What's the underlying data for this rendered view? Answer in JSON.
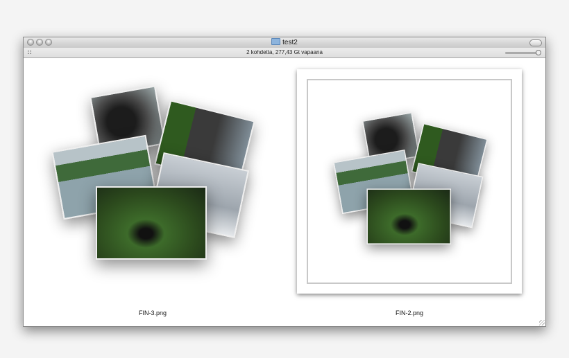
{
  "window": {
    "title": "test2",
    "status": "2 kohdetta, 277,43 Gt vapaana"
  },
  "files": [
    {
      "name": "FIN-3.png"
    },
    {
      "name": "FIN-2.png"
    }
  ]
}
